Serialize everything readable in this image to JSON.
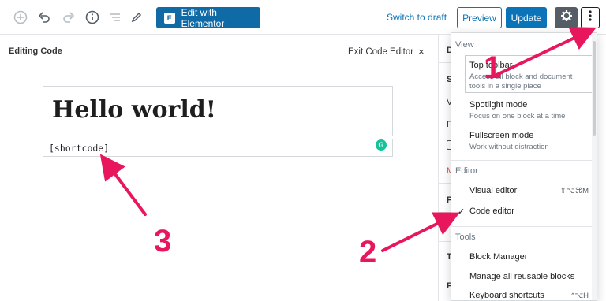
{
  "toolbar": {
    "elementor_label": "Edit with Elementor",
    "elementor_badge": "E",
    "switch_draft": "Switch to draft",
    "preview": "Preview",
    "update": "Update"
  },
  "editor": {
    "mode_label": "Editing Code",
    "exit_label": "Exit Code Editor",
    "exit_icon": "×",
    "title": "Hello world!",
    "code": "[shortcode]",
    "grammarly_badge": "G"
  },
  "sidebar_peek": {
    "letters": [
      "D",
      "S",
      "V",
      "F",
      "M",
      "P",
      "T",
      "F"
    ]
  },
  "menu": {
    "view_label": "View",
    "view_items": [
      {
        "title": "Top toolbar",
        "desc_line1": "Access all block and document",
        "desc_line2": "tools in a single place"
      },
      {
        "title": "Spotlight mode",
        "desc_line1": "Focus on one block at a time"
      },
      {
        "title": "Fullscreen mode",
        "desc_line1": "Work without distraction"
      }
    ],
    "editor_label": "Editor",
    "editor_items": [
      {
        "title": "Visual editor",
        "shortcut": "⇧⌥⌘M"
      },
      {
        "title": "Code editor",
        "checked": "✓"
      }
    ],
    "tools_label": "Tools",
    "tools_items": [
      {
        "title": "Block Manager"
      },
      {
        "title": "Manage all reusable blocks"
      },
      {
        "title": "Keyboard shortcuts",
        "shortcut": "^⌥H"
      }
    ]
  },
  "annotations": {
    "one": "1",
    "two": "2",
    "three": "3",
    "color": "#e8175d"
  }
}
